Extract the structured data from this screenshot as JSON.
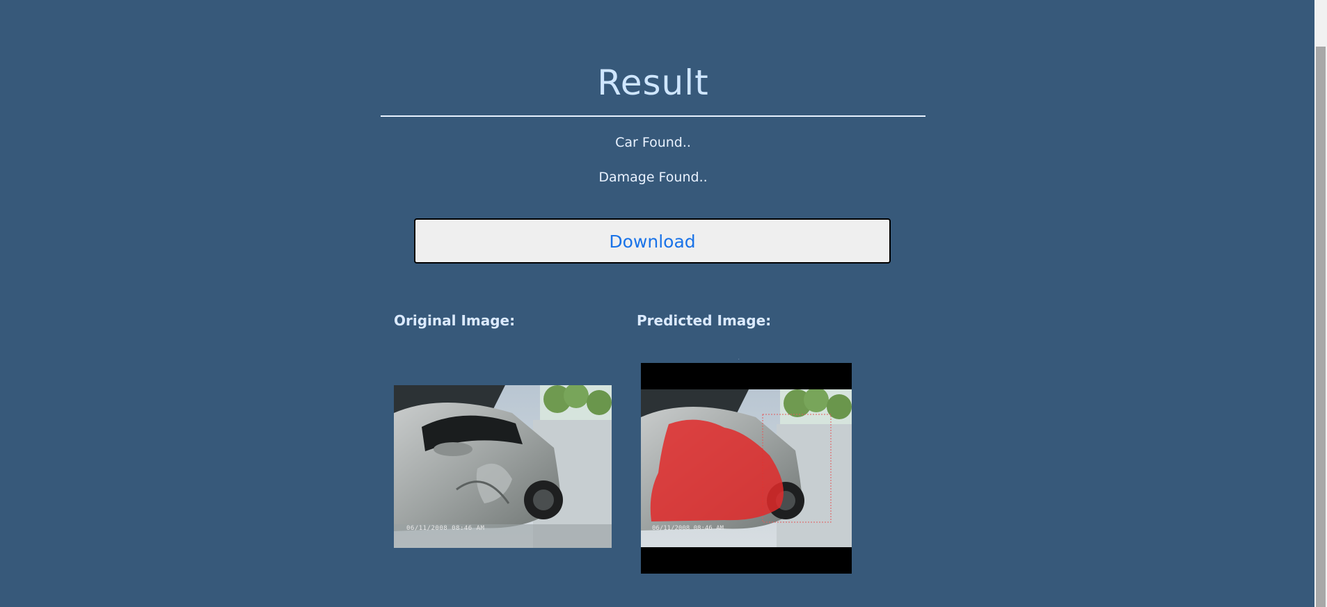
{
  "header": {
    "title": "Result"
  },
  "status": {
    "car": "Car Found..",
    "damage": "Damage Found.."
  },
  "actions": {
    "download_label": "Download"
  },
  "images": {
    "original_label": "Original Image:",
    "predicted_label": "Predicted Image:",
    "original_stamp": "06/11/2008 08:46 AM",
    "predicted_stamp": "06/11/2008 08:46 AM"
  },
  "colors": {
    "background": "#37597a",
    "title": "#cfe6ff",
    "button_text": "#1a73e8",
    "mask": "#e02a2a"
  }
}
